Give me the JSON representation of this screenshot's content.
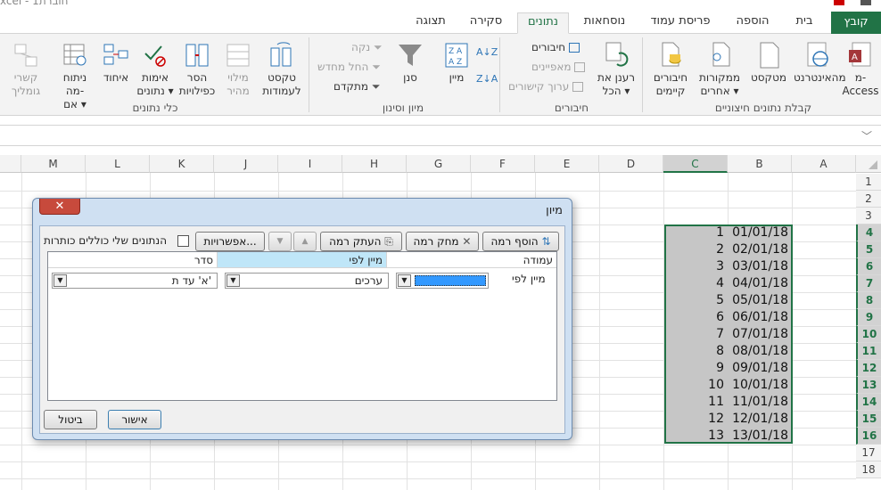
{
  "window": {
    "title_fragment": "xcel - חוברת1"
  },
  "tabs": [
    {
      "id": "file",
      "label": "קובץ"
    },
    {
      "id": "home",
      "label": "בית"
    },
    {
      "id": "insert",
      "label": "הוספה"
    },
    {
      "id": "layout",
      "label": "פריסת עמוד"
    },
    {
      "id": "formulas",
      "label": "נוסחאות"
    },
    {
      "id": "data",
      "label": "נתונים"
    },
    {
      "id": "review",
      "label": "סקירה"
    },
    {
      "id": "view",
      "label": "תצוגה"
    }
  ],
  "ribbon": {
    "external": {
      "group_label": "קבלת נתונים חיצוניים",
      "access": "מ-\nAccess",
      "web": "מהאינטרנט",
      "text": "מטקסט",
      "other": "ממקורות\nאחרים ▾",
      "existing": "חיבורים\nקיימים"
    },
    "connections": {
      "group_label": "חיבורים",
      "refresh": "רענן את\nהכל ▾",
      "conn": "חיבורים",
      "props": "מאפיינים",
      "links": "ערוך קישורים"
    },
    "sortfilter": {
      "group_label": "מיון וסינון",
      "az": "A↓Z",
      "za": "Z↓A",
      "sort": "מיין",
      "filter": "סנן",
      "clear": "נקה",
      "reapply": "החל מחדש",
      "advanced": "מתקדם"
    },
    "datatools": {
      "group_label": "כלי נתונים",
      "text_to_cols": "טקסט\nלעמודות",
      "flash_fill": "מילוי\nמהיר",
      "remove_dup": "הסר\nכפילויות",
      "validation": "אימות\nנתונים ▾",
      "consolidate": "איחוד",
      "whatif": "ניתוח מה-\nאם ▾",
      "relationships": "קשרי\nגומליך"
    }
  },
  "grid": {
    "columns": [
      "A",
      "B",
      "C",
      "D",
      "E",
      "F",
      "G",
      "H",
      "I",
      "J",
      "K",
      "L",
      "M"
    ],
    "rows": [
      1,
      2,
      3,
      4,
      5,
      6,
      7,
      8,
      9,
      10,
      11,
      12,
      13,
      14,
      15,
      16,
      17,
      18
    ],
    "data_rows": [
      {
        "b": "01/01/18",
        "c": "1"
      },
      {
        "b": "02/01/18",
        "c": "2"
      },
      {
        "b": "03/01/18",
        "c": "3"
      },
      {
        "b": "04/01/18",
        "c": "4"
      },
      {
        "b": "05/01/18",
        "c": "5"
      },
      {
        "b": "06/01/18",
        "c": "6"
      },
      {
        "b": "07/01/18",
        "c": "7"
      },
      {
        "b": "08/01/18",
        "c": "8"
      },
      {
        "b": "09/01/18",
        "c": "9"
      },
      {
        "b": "10/01/18",
        "c": "10"
      },
      {
        "b": "11/01/18",
        "c": "11"
      },
      {
        "b": "12/01/18",
        "c": "12"
      },
      {
        "b": "13/01/18",
        "c": "13"
      }
    ]
  },
  "dialog": {
    "title": "מיון",
    "close": "✕",
    "add_level": "הוסף רמה",
    "delete_level": "מחק רמה",
    "copy_level": "העתק רמה",
    "up": "▲",
    "down": "▼",
    "options": "אפשרויות...",
    "headers_checkbox": "הנתונים שלי כוללים כותרות",
    "col_headers": {
      "column": "עמודה",
      "sort_on": "מיין לפי",
      "order": "סדר"
    },
    "row_label": "מיין לפי",
    "sort_on_value": "ערכים",
    "order_value": "א' עד ת'",
    "ok": "אישור",
    "cancel": "ביטול"
  }
}
